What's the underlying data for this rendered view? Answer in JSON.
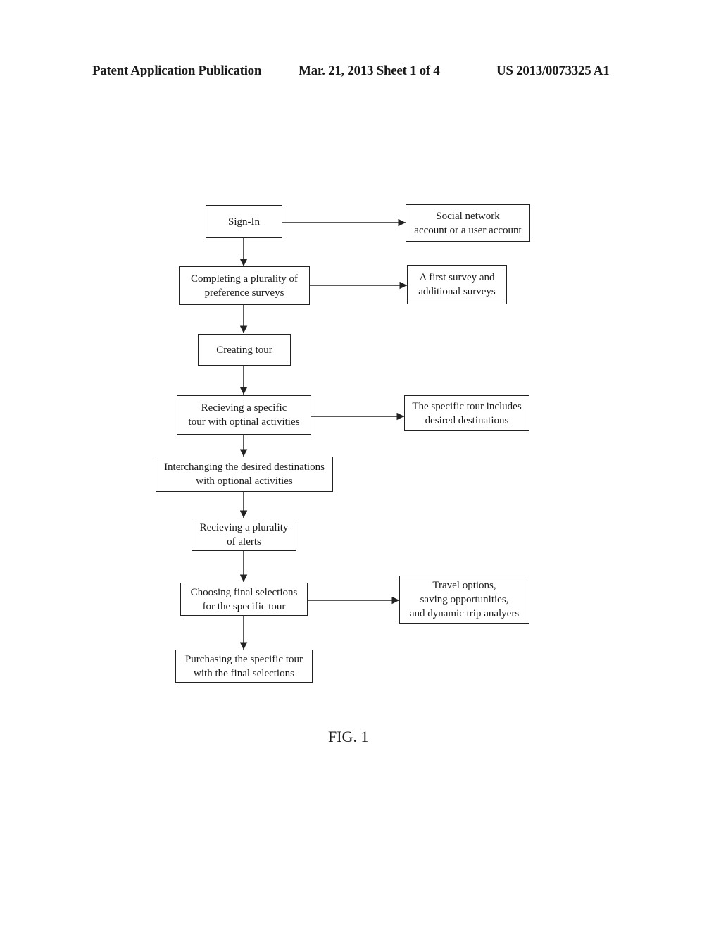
{
  "header": {
    "left": "Patent Application Publication",
    "center": "Mar. 21, 2013  Sheet 1 of 4",
    "right": "US 2013/0073325 A1"
  },
  "flowchart": {
    "steps": [
      "Sign-In",
      "Completing a plurality of\npreference surveys",
      "Creating tour",
      "Recieving a specific\ntour with optinal activities",
      "Interchanging the desired destinations\nwith optional activities",
      "Recieving a plurality\nof alerts",
      "Choosing final selections\nfor the specific tour",
      "Purchasing the specific tour\nwith the final selections"
    ],
    "side_notes": [
      "Social network\naccount or a user account",
      "A first survey and\nadditional surveys",
      "The specific tour includes\ndesired destinations",
      "Travel options,\nsaving opportunities,\nand dynamic trip analyers"
    ]
  },
  "figure_label": "FIG. 1"
}
